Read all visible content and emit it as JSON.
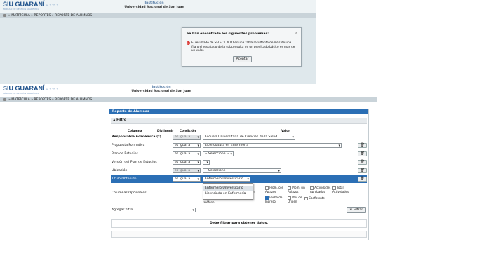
{
  "brand": {
    "name": "SIU GUARANÍ",
    "tagline": "MÓDULO DE GESTIÓN ACADÉMICA",
    "version": "v. 3.21.3"
  },
  "institution": {
    "label": "Institución",
    "name": "Universidad Nacional de San Juan"
  },
  "breadcrumb": {
    "text": "» MATRÍCULA » REPORTES » REPORTE DE ALUMNOS"
  },
  "modal": {
    "title": "Se han encontrado los siguientes problemas:",
    "message": "El resultado de SELECT INTO es una tabla resultante de más de una fila o el resultado de la subconsulta de un predicado básico es más de un valor.",
    "accept": "Aceptar"
  },
  "report": {
    "title": "Reporte de Alumnos",
    "filter_title": "Filtro",
    "col_columna": "Columna",
    "col_distinguir": "Distinguir",
    "col_condicion": "Condición",
    "col_valor": "Valor",
    "rows": [
      {
        "label": "Responsable Académica (*)",
        "cond": "es igual a",
        "value": "Escuela Universitaria de Ciencias de la Salud"
      },
      {
        "label": "Propuesta Formativa",
        "cond": "es igual a",
        "value": "Licenciatura en Enfermería"
      },
      {
        "label": "Plan de Estudios",
        "cond": "es igual a",
        "value": "-- Seleccione --"
      },
      {
        "label": "Versión del Plan de Estudios",
        "cond": "es igual a",
        "value": ""
      },
      {
        "label": "Ubicación",
        "cond": "es igual a",
        "value": "-- Seleccione --"
      },
      {
        "label": "Título Obtenido",
        "cond": "es igual a",
        "value": "Enfermero Universitario"
      }
    ],
    "dropdown_options": [
      "Enfermero Universitario",
      "Licenciado en Enfermería"
    ],
    "optional_label": "Columnas Opcionales",
    "optional_cols": [
      {
        "label": "Prom. con Aplazos",
        "checked": false
      },
      {
        "label": "Prom. sin Aplazos",
        "checked": false
      },
      {
        "label": "Actividades Aprobadas",
        "checked": false
      },
      {
        "label": "Total Actividades",
        "checked": false
      },
      {
        "label": "Fecha de Ingreso",
        "checked": true
      },
      {
        "label": "País de Origen",
        "checked": false
      },
      {
        "label": "Coeficiente",
        "checked": false
      }
    ],
    "partial_texts": [
      "ción",
      "nacimiento",
      "teléfono"
    ],
    "add_filter_label": "Agregar filtro",
    "filter_button": "Filtrar",
    "message": "Debe filtrar para obtener datos."
  }
}
